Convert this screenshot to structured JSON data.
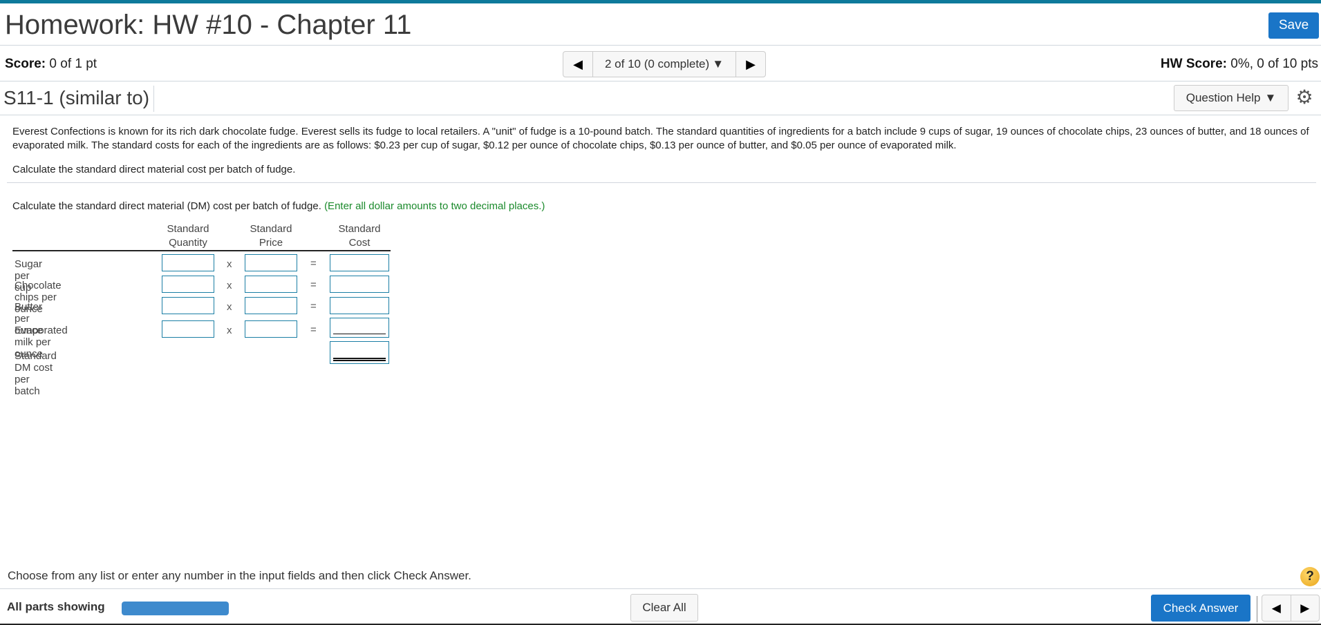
{
  "header": {
    "title": "Homework: HW #10 - Chapter 11",
    "save_label": "Save"
  },
  "score": {
    "label": "Score:",
    "value": "0 of 1 pt",
    "hw_label": "HW Score:",
    "hw_value": "0%, 0 of 10 pts"
  },
  "navigator": {
    "prev_icon": "◀",
    "position_text": "2 of 10 (0 complete)",
    "dropdown_icon": "▼",
    "next_icon": "▶"
  },
  "question": {
    "id": "S11-1 (similar to)",
    "help_label": "Question Help",
    "help_icon": "▼",
    "settings_icon": "⚙"
  },
  "problem": {
    "text": "Everest Confections is known for its rich dark chocolate fudge. Everest sells its fudge to local retailers. A \"unit\" of fudge is a 10-pound batch. The standard quantities of ingredients for a batch include 9 cups of sugar, 19 ounces of chocolate chips, 23 ounces of butter, and 18 ounces of evaporated milk. The standard costs for each of the ingredients are as follows: $0.23 per cup of sugar, $0.12 per ounce of chocolate chips, $0.13 per ounce of butter, and $0.05 per ounce of evaporated milk.",
    "task": "Calculate the standard direct material cost per batch of fudge.",
    "part_instruction": "Calculate the standard direct material (DM) cost per batch of fudge.",
    "part_hint": "(Enter all dollar amounts to two decimal places.)"
  },
  "table": {
    "headers": [
      {
        "line1": "Standard",
        "line2": "Quantity"
      },
      {
        "line1": "Standard",
        "line2": "Price"
      },
      {
        "line1": "Standard",
        "line2": "Cost"
      }
    ],
    "times_symbol": "x",
    "equals_symbol": "=",
    "rows": [
      {
        "label": "Sugar per cup",
        "quantity": "",
        "price": "",
        "cost": ""
      },
      {
        "label": "Chocolate chips per ounce",
        "quantity": "",
        "price": "",
        "cost": ""
      },
      {
        "label": "Butter per ounce",
        "quantity": "",
        "price": "",
        "cost": ""
      },
      {
        "label": "Evaporated milk per ounce",
        "quantity": "",
        "price": "",
        "cost": ""
      }
    ],
    "total_label": "Standard DM cost per batch",
    "total_value": ""
  },
  "footer": {
    "instruction": "Choose from any list or enter any number in the input fields and then click Check Answer.",
    "help_icon": "?",
    "parts_label": "All parts showing",
    "progress": 1.0,
    "clear_label": "Clear All",
    "check_label": "Check Answer",
    "prev_icon": "◀",
    "next_icon": "▶"
  }
}
